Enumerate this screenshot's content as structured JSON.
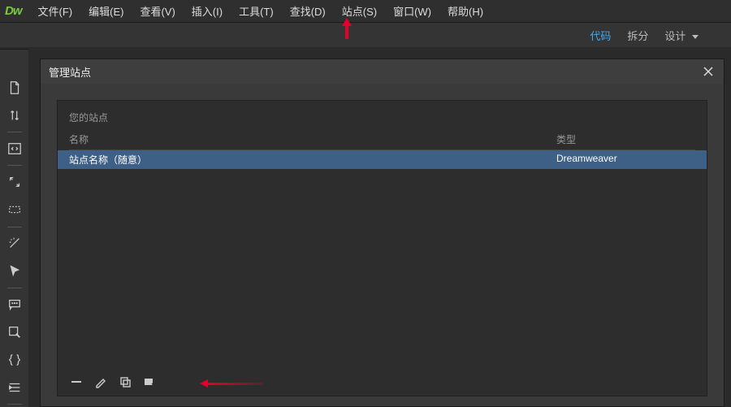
{
  "app_logo": "Dw",
  "menubar": [
    "文件(F)",
    "编辑(E)",
    "查看(V)",
    "插入(I)",
    "工具(T)",
    "查找(D)",
    "站点(S)",
    "窗口(W)",
    "帮助(H)"
  ],
  "view_tabs": {
    "code": "代码",
    "split": "拆分",
    "design": "设计"
  },
  "modal": {
    "title": "管理站点",
    "your_sites": "您的站点",
    "col_name": "名称",
    "col_type": "类型",
    "row": {
      "name": "站点名称（随意）",
      "type": "Dreamweaver"
    }
  }
}
